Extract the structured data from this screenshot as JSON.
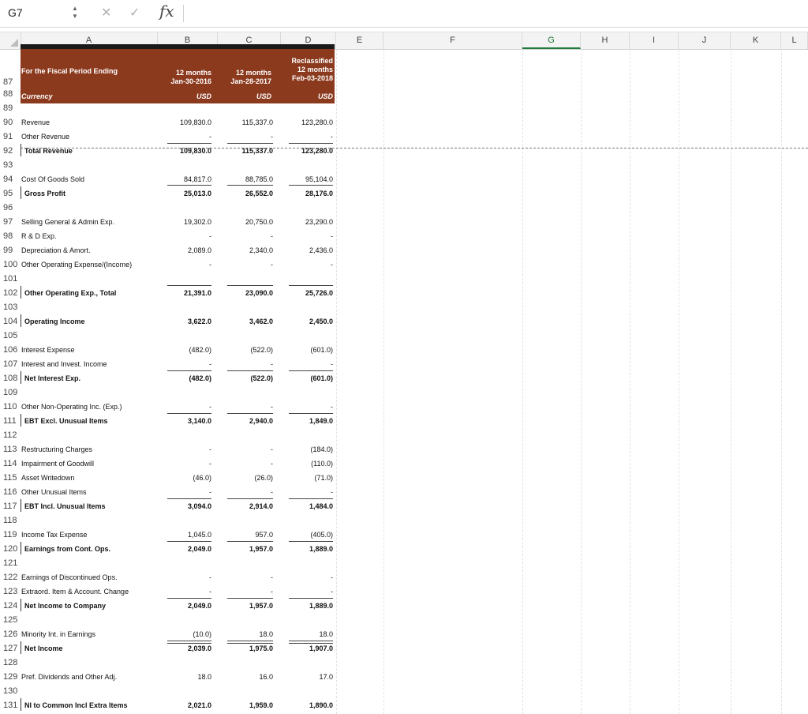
{
  "formula_bar": {
    "name_box": "G7",
    "fx": "fx",
    "formula": ""
  },
  "columns": [
    "A",
    "B",
    "C",
    "D",
    "E",
    "F",
    "G",
    "H",
    "I",
    "J",
    "K",
    "L"
  ],
  "active_column": "G",
  "header": {
    "period_label": "For the Fiscal Period Ending",
    "currency_label": "Currency",
    "col_b": {
      "line1": "12 months",
      "line2": "Jan-30-2016",
      "currency": "USD"
    },
    "col_c": {
      "line1": "12 months",
      "line2": "Jan-28-2017",
      "currency": "USD"
    },
    "col_d": {
      "line0": "Reclassified",
      "line1": "12 months",
      "line2": "Feb-03-2018",
      "currency": "USD"
    }
  },
  "rows": [
    {
      "n": "87"
    },
    {
      "n": "88"
    },
    {
      "n": "89",
      "label": "",
      "b": "",
      "c": "",
      "d": ""
    },
    {
      "n": "90",
      "label": "Revenue",
      "b": "109,830.0",
      "c": "115,337.0",
      "d": "123,280.0"
    },
    {
      "n": "91",
      "label": "Other Revenue",
      "b": "-",
      "c": "-",
      "d": "-"
    },
    {
      "n": "92",
      "label": "Total Revenue",
      "bold": true,
      "b": "109,830.0",
      "c": "115,337.0",
      "d": "123,280.0"
    },
    {
      "n": "93",
      "label": "",
      "b": "",
      "c": "",
      "d": ""
    },
    {
      "n": "94",
      "label": "Cost Of Goods Sold",
      "b": "84,817.0",
      "c": "88,785.0",
      "d": "95,104.0"
    },
    {
      "n": "95",
      "label": "Gross Profit",
      "bold": true,
      "b": "25,013.0",
      "c": "26,552.0",
      "d": "28,176.0"
    },
    {
      "n": "96",
      "label": "",
      "b": "",
      "c": "",
      "d": ""
    },
    {
      "n": "97",
      "label": "Selling General & Admin Exp.",
      "b": "19,302.0",
      "c": "20,750.0",
      "d": "23,290.0"
    },
    {
      "n": "98",
      "label": "R & D Exp.",
      "b": "-",
      "c": "-",
      "d": "-"
    },
    {
      "n": "99",
      "label": "Depreciation & Amort.",
      "b": "2,089.0",
      "c": "2,340.0",
      "d": "2,436.0"
    },
    {
      "n": "100",
      "label": "Other Operating Expense/(Income)",
      "b": "-",
      "c": "-",
      "d": "-"
    },
    {
      "n": "101",
      "label": "",
      "b": "",
      "c": "",
      "d": ""
    },
    {
      "n": "102",
      "label": "Other Operating Exp., Total",
      "bold": true,
      "b": "21,391.0",
      "c": "23,090.0",
      "d": "25,726.0"
    },
    {
      "n": "103",
      "label": "",
      "b": "",
      "c": "",
      "d": ""
    },
    {
      "n": "104",
      "label": "Operating Income",
      "bold": true,
      "b": "3,622.0",
      "c": "3,462.0",
      "d": "2,450.0"
    },
    {
      "n": "105",
      "label": "",
      "b": "",
      "c": "",
      "d": ""
    },
    {
      "n": "106",
      "label": "Interest Expense",
      "b": "(482.0)",
      "c": "(522.0)",
      "d": "(601.0)"
    },
    {
      "n": "107",
      "label": "Interest and Invest. Income",
      "b": "-",
      "c": "-",
      "d": "-"
    },
    {
      "n": "108",
      "label": "Net Interest Exp.",
      "bold": true,
      "b": "(482.0)",
      "c": "(522.0)",
      "d": "(601.0)"
    },
    {
      "n": "109",
      "label": "",
      "b": "",
      "c": "",
      "d": ""
    },
    {
      "n": "110",
      "label": "Other Non-Operating Inc. (Exp.)",
      "b": "-",
      "c": "-",
      "d": "-"
    },
    {
      "n": "111",
      "label": "EBT Excl. Unusual Items",
      "bold": true,
      "b": "3,140.0",
      "c": "2,940.0",
      "d": "1,849.0"
    },
    {
      "n": "112",
      "label": "",
      "b": "",
      "c": "",
      "d": ""
    },
    {
      "n": "113",
      "label": "Restructuring Charges",
      "b": "-",
      "c": "-",
      "d": "(184.0)"
    },
    {
      "n": "114",
      "label": "Impairment of Goodwill",
      "b": "-",
      "c": "-",
      "d": "(110.0)"
    },
    {
      "n": "115",
      "label": "Asset Writedown",
      "b": "(46.0)",
      "c": "(26.0)",
      "d": "(71.0)"
    },
    {
      "n": "116",
      "label": "Other Unusual Items",
      "b": "-",
      "c": "-",
      "d": "-"
    },
    {
      "n": "117",
      "label": "EBT Incl. Unusual Items",
      "bold": true,
      "b": "3,094.0",
      "c": "2,914.0",
      "d": "1,484.0"
    },
    {
      "n": "118",
      "label": "",
      "b": "",
      "c": "",
      "d": ""
    },
    {
      "n": "119",
      "label": "Income Tax Expense",
      "b": "1,045.0",
      "c": "957.0",
      "d": "(405.0)"
    },
    {
      "n": "120",
      "label": "Earnings from Cont. Ops.",
      "bold": true,
      "b": "2,049.0",
      "c": "1,957.0",
      "d": "1,889.0"
    },
    {
      "n": "121",
      "label": "",
      "b": "",
      "c": "",
      "d": ""
    },
    {
      "n": "122",
      "label": "Earnings of Discontinued Ops.",
      "b": "-",
      "c": "-",
      "d": "-"
    },
    {
      "n": "123",
      "label": "Extraord. Item & Account. Change",
      "b": "-",
      "c": "-",
      "d": "-"
    },
    {
      "n": "124",
      "label": "Net Income to Company",
      "bold": true,
      "b": "2,049.0",
      "c": "1,957.0",
      "d": "1,889.0"
    },
    {
      "n": "125",
      "label": "",
      "b": "",
      "c": "",
      "d": ""
    },
    {
      "n": "126",
      "label": "Minority Int. in Earnings",
      "b": "(10.0)",
      "c": "18.0",
      "d": "18.0"
    },
    {
      "n": "127",
      "label": "Net Income",
      "bold": true,
      "b": "2,039.0",
      "c": "1,975.0",
      "d": "1,907.0"
    },
    {
      "n": "128",
      "label": "",
      "b": "",
      "c": "",
      "d": ""
    },
    {
      "n": "129",
      "label": "Pref. Dividends and Other Adj.",
      "b": "18.0",
      "c": "16.0",
      "d": "17.0"
    },
    {
      "n": "130",
      "label": "",
      "b": "",
      "c": "",
      "d": ""
    },
    {
      "n": "131",
      "label": "NI to Common Incl Extra Items",
      "bold": true,
      "b": "2,021.0",
      "c": "1,959.0",
      "d": "1,890.0"
    }
  ]
}
